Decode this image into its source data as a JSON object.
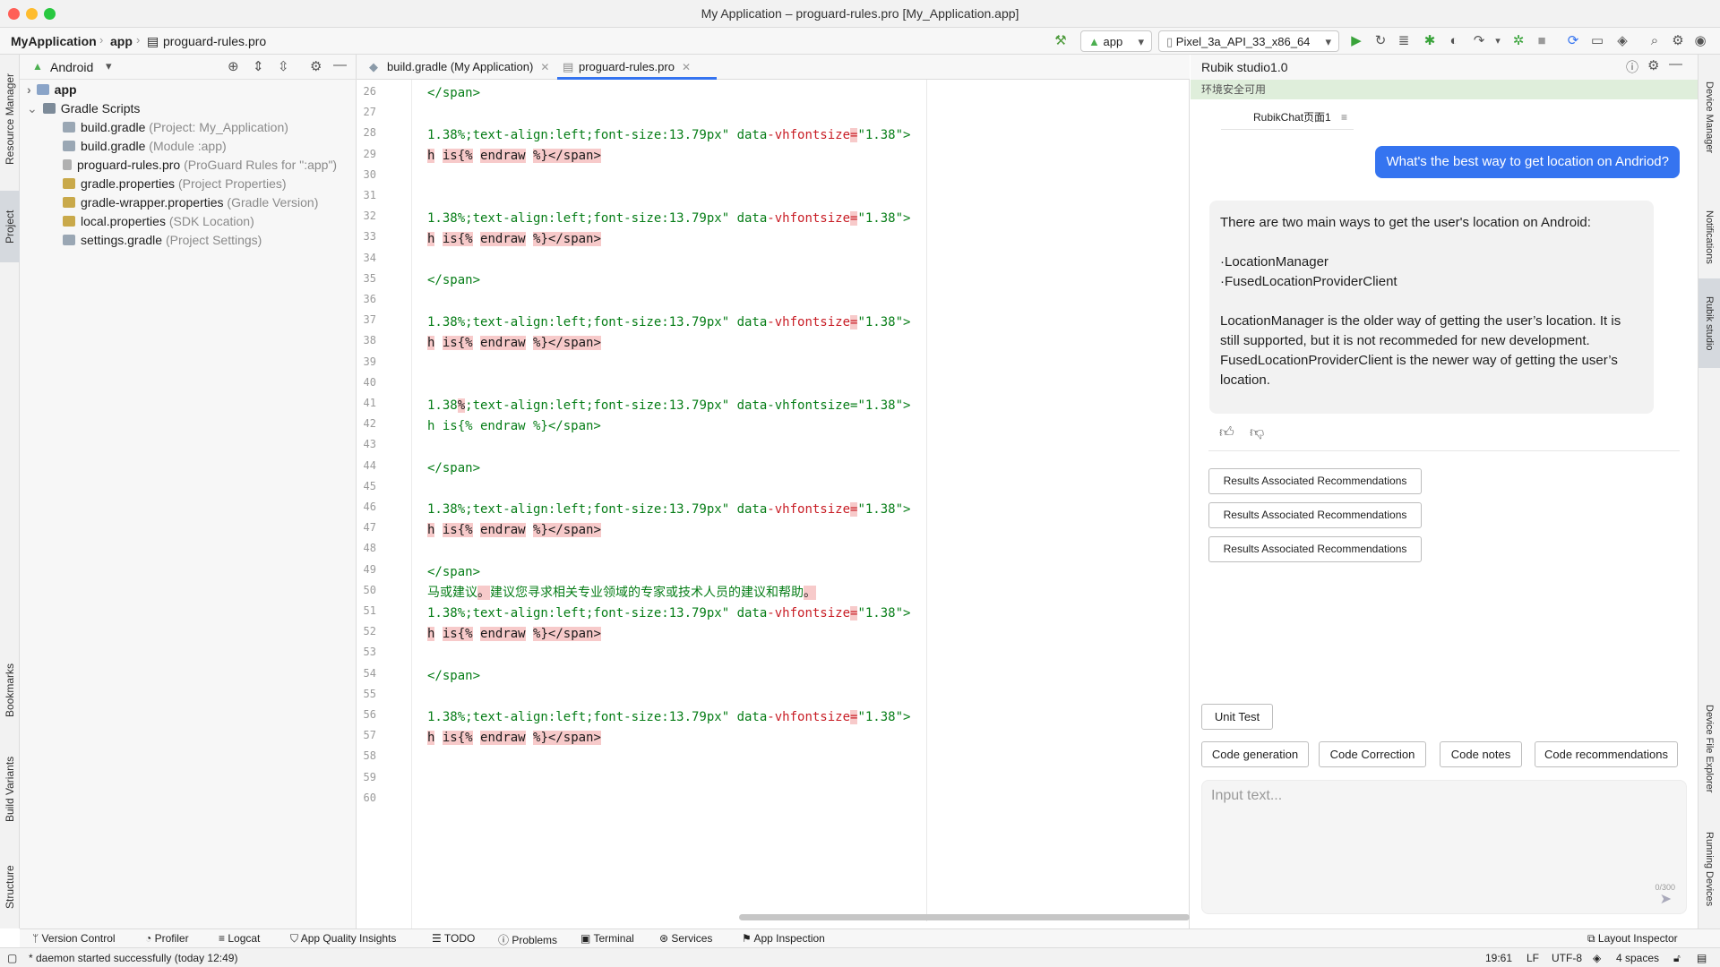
{
  "window": {
    "title": "My Application – proguard-rules.pro [My_Application.app]",
    "traffic_colors": [
      "#ff5f57",
      "#febc2e",
      "#28c840"
    ]
  },
  "toolbar": {
    "breadcrumb": [
      "MyApplication",
      "app",
      "proguard-rules.pro"
    ],
    "run_config": "app",
    "device": "Pixel_3a_API_33_x86_64"
  },
  "left_strip": {
    "tabs": [
      "Resource Manager",
      "Project",
      "Bookmarks",
      "Build Variants",
      "Structure"
    ]
  },
  "project_panel": {
    "view": "Android",
    "tree": [
      {
        "label": "app",
        "hint": ""
      },
      {
        "label": "Gradle Scripts",
        "hint": ""
      },
      {
        "label": "build.gradle",
        "hint": "(Project: My_Application)"
      },
      {
        "label": "build.gradle",
        "hint": "(Module :app)"
      },
      {
        "label": "proguard-rules.pro",
        "hint": "(ProGuard Rules for \":app\")"
      },
      {
        "label": "gradle.properties",
        "hint": "(Project Properties)"
      },
      {
        "label": "gradle-wrapper.properties",
        "hint": "(Gradle Version)"
      },
      {
        "label": "local.properties",
        "hint": "(SDK Location)"
      },
      {
        "label": "settings.gradle",
        "hint": "(Project Settings)"
      }
    ]
  },
  "editor": {
    "tabs": [
      {
        "label": "build.gradle (My Application)",
        "active": false
      },
      {
        "label": "proguard-rules.pro",
        "active": true
      }
    ],
    "line_numbers": [
      "26",
      "27",
      "28",
      "29",
      "30",
      "31",
      "32",
      "33",
      "34",
      "35",
      "36",
      "37",
      "38",
      "39",
      "40",
      "41",
      "42",
      "43",
      "44",
      "45",
      "46",
      "47",
      "48",
      "49",
      "50",
      "51",
      "52",
      "53",
      "54",
      "55",
      "56",
      "57",
      "58",
      "59",
      "60"
    ],
    "code": {
      "span_close": "</span>",
      "style_prefix": "1.38%;text-align:left;font-size:13.79px\" data",
      "attr_name": "-vhfontsize",
      "attr_eq": "=",
      "attr_value": "\"1.38\">",
      "h": "h",
      "is": "is{%",
      "endraw": "endraw",
      "tag_end": "%}</span>",
      "line42_a": "1.38",
      "line42_b": "%",
      "line42_c": ";text-align:left;font-size:13.79px\" data-vhfontsize=\"1.38\">",
      "line43": "h is{% endraw %}</span>",
      "line51_a": "马或建议",
      "line51_b": "。",
      "line51_c": "建议您寻求相关专业领域的专家或技术人员的建议和帮助",
      "line51_d": "。"
    }
  },
  "rubik": {
    "title": "Rubik studio1.0",
    "banner": "环境安全可用",
    "chat_tab": "RubikChat页面1",
    "user_message": "What's the best way to get location on Andriod?",
    "bot_message": {
      "intro": "There are two main ways to get the user's location on Android:",
      "bullet_1": "·LocationManager",
      "bullet_2": "·FusedLocationProviderClient",
      "detail": "LocationManager is the older way of getting the user’s location. It is still supported, but it is not recommeded for new development. FusedLocationProviderClient is the newer way of getting the user’s location."
    },
    "recommendations": [
      "Results Associated Recommendations",
      "Results Associated Recommendations",
      "Results Associated Recommendations"
    ],
    "unit_test": "Unit Test",
    "actions": [
      "Code generation",
      "Code Correction",
      "Code notes",
      "Code recommendations"
    ],
    "input_placeholder": "Input text...",
    "char_count": "0/300"
  },
  "right_strip": {
    "tabs": [
      "Device Manager",
      "Notifications",
      "Rubik studio",
      "Device File Explorer",
      "Running Devices"
    ]
  },
  "bottom_tools": [
    "Version Control",
    "Profiler",
    "Logcat",
    "App Quality Insights",
    "TODO",
    "Problems",
    "Terminal",
    "Services",
    "App Inspection",
    "Layout Inspector"
  ],
  "status": {
    "message": "* daemon started successfully (today 12:49)",
    "position": "19:61",
    "line_sep": "LF",
    "encoding": "UTF-8",
    "indent": "4 spaces"
  },
  "colors": {
    "accent": "#3574f0",
    "string_green": "#067d17",
    "error_red": "#c81d25",
    "error_highlight": "#f7caca",
    "banner_green": "#dfeedb"
  }
}
